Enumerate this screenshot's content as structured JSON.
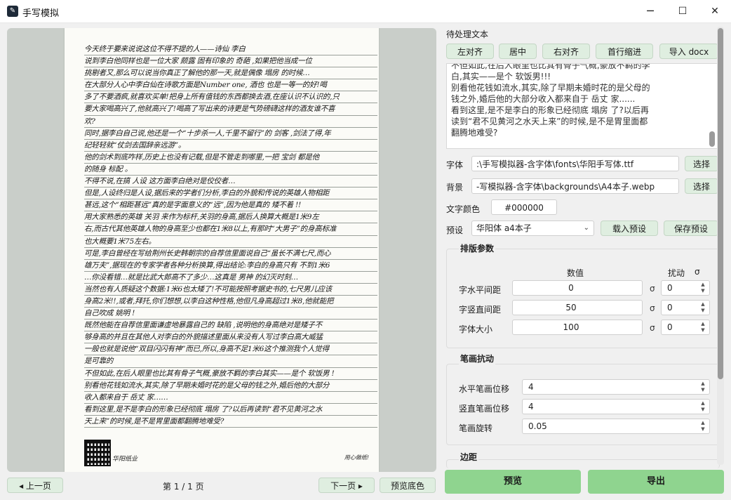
{
  "window": {
    "title": "手写模拟",
    "minimize": "─",
    "maximize": "☐",
    "close": "✕"
  },
  "preview": {
    "lines": [
      "今天终于要来说说这位不得不提的人——诗仙  李白",
      "说到李白他同样也是一位大家  颇露  固有印象的  奇葩  ,如果把他当成一位",
      "挑剔者又,那么可以说当你真正了解他的那一天,就是偶像  塌房  的时候…",
      "在大部分人心中李白仙在诗歌方面是Number one,  酒也  也是一等一的好!喝",
      "多了不要酒疯,就喜欢买单!把身上所有值钱的东西都换去酒,在座认识不认识的,只",
      "要大家喝高兴了,他就高兴了!喝高了写出来的诗更是气势磅礴这样的酒友谁不喜",
      "欢?",
      "同时,据李白自己说,他还是一个“十步杀一人,千里不留行”的  剑客  ,剑法了得,年",
      "纪轻轻就“仗剑去国辞亲远游”。",
      "他的剑术到底咋样,历史上也没有记载,但是不管走到哪里,一把  宝剑  都是他",
      "的随身  标配  。",
      "不得不说,在搞  人设  这方面李白绝对是佼佼者…",
      "但是,人设终归是人设,据后来的学者们分析,李白的外貌和传说的英雄人物相距",
      "甚远,这个“相距甚远”真的是字面意义的“远”,因为他是真的  矮不着  !!",
      "用大家熟悉的英雄  关羽  来作为标杆,关羽的身高,据后人换算大概是1米9左",
      "右,而古代其他英雄人物的身高至少也都在1米8以上,有那时“大男子”的身高标准",
      "也大概要1米75左右。",
      "可是,李白曾经在写给荆州长史韩朝宗的自荐信里面说自己“虽长不满七尺,而心",
      "雄万夫”,据现在的专家学者各种分析换算,得出结论:李白的身高只有  不到1米6",
      "…你没看错…就是比武大郎高不了多少…这真是  男神  的幻灭时刻…",
      "当然也有人质疑这个数据:1米6也太矮了!不可能按照考据史书的,七尺男儿应该",
      "身高2米!!,或者,拜托,你们想想,以李白这种性格,他但凡身高超过1米8,他就能把",
      "自己吹成  姚明  !",
      "既然他能在自荐信里面谦虚地暴露自己的  缺陷  ,说明他的身高绝对是矮子不",
      "够身高的并且在其他人对李白的外貌描述里面从来没有人写过李白高大威猛",
      "一般也就是说他“双目闪闪有神”而已,所以,身高不足1米6这个推测我个人觉得",
      "是可靠的",
      "不但如此,在后人眼里也比其有骨子气概,豪放不羁的李白其实——是个  软饭男  !",
      "别看他花钱如流水,其实,除了早期未婚时花的是父母的钱之外,婚后他的大部分",
      "收入都来自于  岳丈  家……",
      "看到这里,是不是李白的形象已经彻底  塌房  了?以后再读到“君不见黄河之水",
      "天上来”的时候,是不是胃里面都翻腾地难受?"
    ],
    "qr_caption": "华阳纸业",
    "page_footer": "用心做纸!"
  },
  "left_controls": {
    "prev_page": "◂ 上一页",
    "page_info": "第  1  /  1  页",
    "next_page": "下一页 ▸",
    "preview_bg": "预览底色"
  },
  "text_section": {
    "title": "待处理文本",
    "toolbar": {
      "align_left": "左对齐",
      "center": "居中",
      "align_right": "右对齐",
      "indent": "首行缩进",
      "import_docx": "导入 docx"
    },
    "content": [
      "不但如此,在后人眼里也比其有骨子气概,豪放不羁的李",
      "白,其实——是个 软饭男!!!",
      "别看他花钱如流水,其实,除了早期未婚时花的是父母的",
      "钱之外,婚后他的大部分收入都来自于 岳丈 家......",
      "看到这里,是不是李白的形象已经彻底 塌房 了?以后再",
      "读到“君不见黄河之水天上来”的时候,是不是胃里面都",
      "翻腾地难受?"
    ]
  },
  "font_row": {
    "label": "字体",
    "value": ":\\手写模拟器-含字体\\fonts\\华阳手写体.ttf",
    "button": "选择"
  },
  "bg_row": {
    "label": "背景",
    "value": "-写模拟器-含字体\\backgrounds\\A4本子.webp",
    "button": "选择"
  },
  "color_row": {
    "label": "文字颜色",
    "value": "#000000"
  },
  "preset_row": {
    "label": "预设",
    "selected": "华阳体 a4本子",
    "load": "载入预设",
    "save": "保存预设"
  },
  "layout_params": {
    "title": "排版参数",
    "col_value": "数值",
    "col_jitter": "扰动",
    "sigma": "σ",
    "rows": [
      {
        "label": "字水平间距",
        "value": "0",
        "jitter": "0"
      },
      {
        "label": "字竖直间距",
        "value": "50",
        "jitter": "0"
      },
      {
        "label": "字体大小",
        "value": "100",
        "jitter": "0"
      }
    ]
  },
  "stroke_jitter": {
    "title": "笔画抗动",
    "rows": [
      {
        "label": "水平笔画位移",
        "value": "4"
      },
      {
        "label": "竖直笔画位移",
        "value": "4"
      },
      {
        "label": "笔画旋转",
        "value": "0.05"
      }
    ]
  },
  "margin_section": {
    "title": "边距"
  },
  "actions": {
    "preview": "预览",
    "export": "导出"
  },
  "colors": {
    "accent_green": "#8fd48f",
    "button_green": "#dfeee0",
    "preview_bg": "#c9cec9"
  }
}
